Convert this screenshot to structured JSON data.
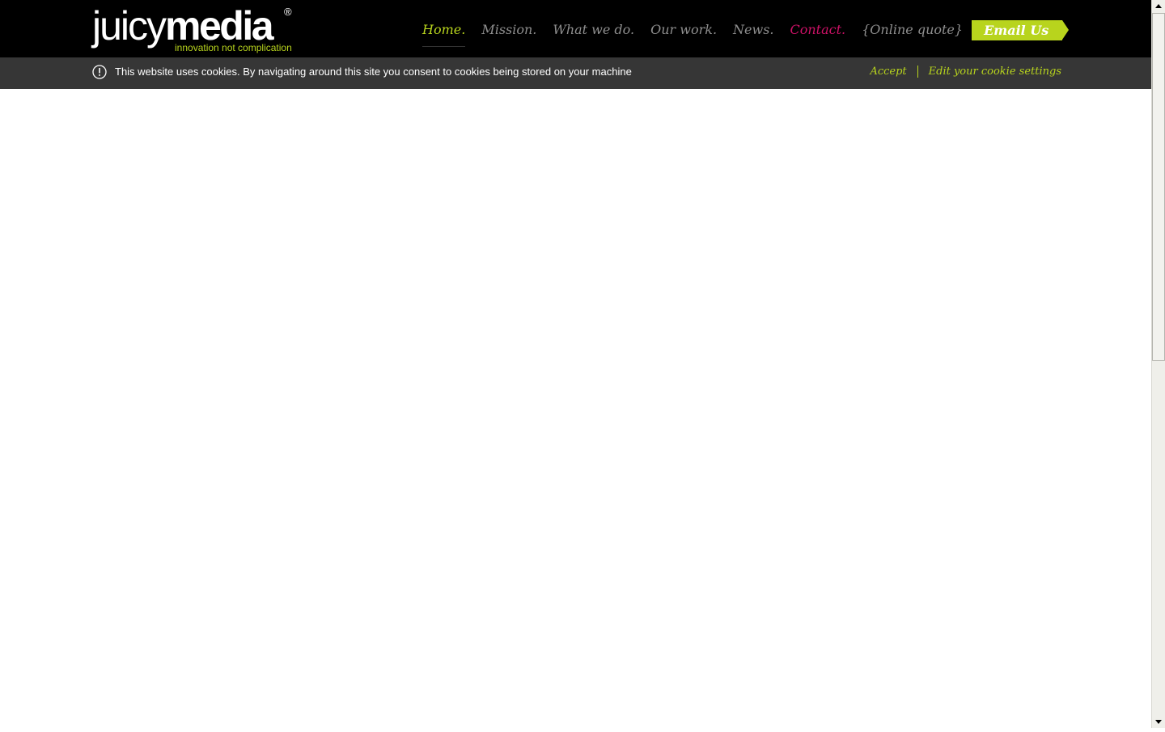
{
  "brand": {
    "name_light": "juicy",
    "name_bold": "media",
    "registered_mark": "®",
    "tagline": "innovation not complication",
    "accent_color": "#b8d41d",
    "contact_color": "#cc1166"
  },
  "nav": {
    "items": [
      {
        "label": "Home.",
        "active": true
      },
      {
        "label": "Mission."
      },
      {
        "label": "What we do."
      },
      {
        "label": "Our work."
      },
      {
        "label": "News."
      },
      {
        "label": "Contact."
      },
      {
        "label": "{Online quote}"
      }
    ],
    "email_button": "Email Us"
  },
  "cookie_bar": {
    "icon": "exclamation-circle-icon",
    "message": "This website uses cookies. By navigating around this site you consent to cookies being stored on your machine",
    "accept": "Accept",
    "edit_settings": "Edit your cookie settings"
  },
  "scrollbar": {
    "up_icon": "triangle-up-icon",
    "down_icon": "triangle-down-icon"
  }
}
